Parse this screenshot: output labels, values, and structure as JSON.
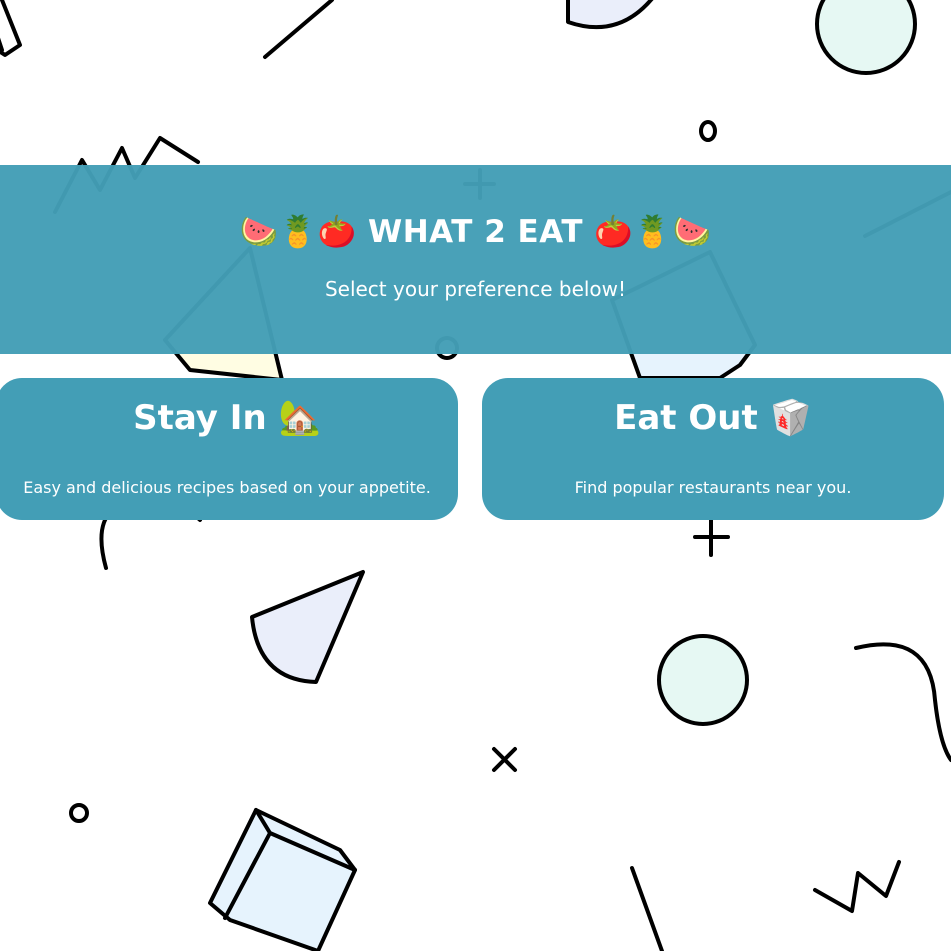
{
  "header": {
    "title": "WHAT 2 EAT",
    "emoji_left": "🍉🍍🍅",
    "emoji_right": "🍅🍍🍉",
    "subtitle": "Select your preference below!"
  },
  "options": {
    "stay_in": {
      "title": "Stay In",
      "emoji": "🏡",
      "description": "Easy and delicious recipes based on your appetite."
    },
    "eat_out": {
      "title": "Eat Out",
      "emoji": "🥡",
      "description": "Find popular restaurants near you."
    }
  },
  "colors": {
    "primary": "#439eb6",
    "text": "#ffffff",
    "background": "#ffffff",
    "shape_stroke": "#000000",
    "shape_mint": "#e6f8f3",
    "shape_lavender": "#eaeefa",
    "shape_blue": "#e6f3fd",
    "shape_yellow": "#fffde3"
  }
}
